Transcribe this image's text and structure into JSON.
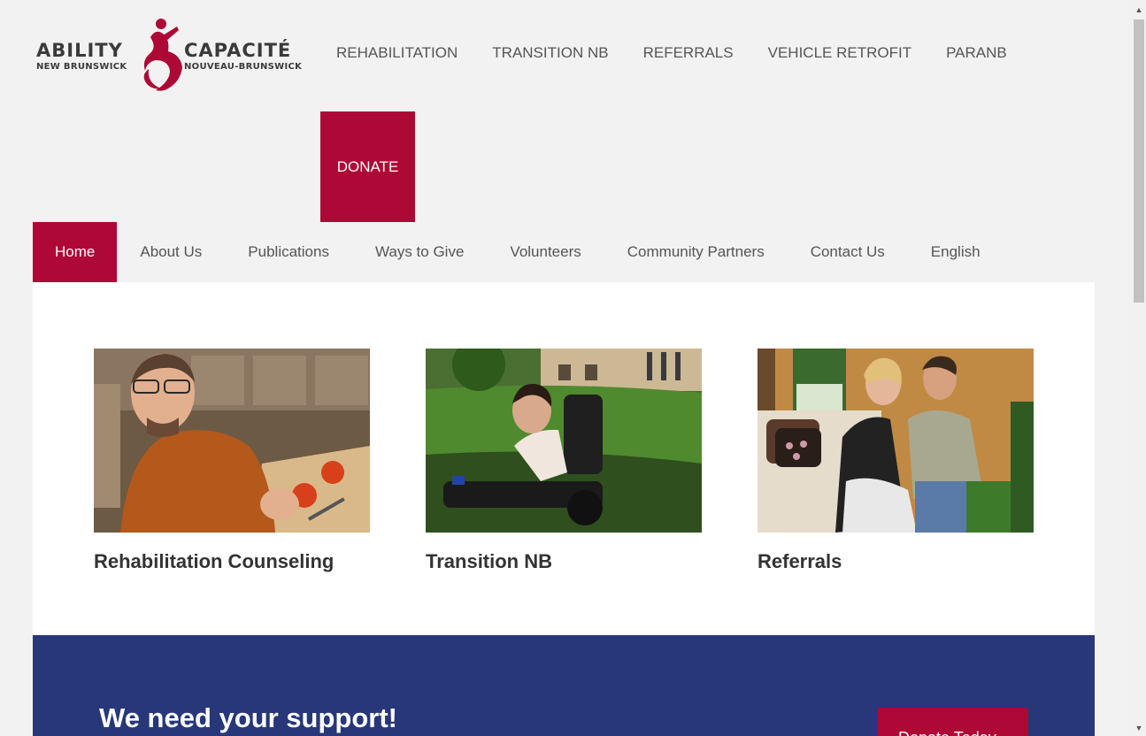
{
  "logo": {
    "left_word": "ABILITY",
    "left_sub": "NEW BRUNSWICK",
    "right_word": "CAPACITÉ",
    "right_sub": "NOUVEAU-BRUNSWICK",
    "icon": "figure-logo-icon",
    "accent": "#ae0936"
  },
  "top_nav": [
    "REHABILITATION",
    "TRANSITION NB",
    "REFERRALS",
    "VEHICLE RETROFIT",
    "PARANB"
  ],
  "donate_label": "DONATE",
  "sub_nav": {
    "items": [
      "Home",
      "About Us",
      "Publications",
      "Ways to Give",
      "Volunteers",
      "Community Partners",
      "Contact Us",
      "English"
    ],
    "active": "Home"
  },
  "tiles": [
    {
      "caption": "Rehabilitation Counseling",
      "image": "man-cutting-tomatoes-photo"
    },
    {
      "caption": "Transition NB",
      "image": "woman-in-wheelchair-photo"
    },
    {
      "caption": "Referrals",
      "image": "couple-on-sofa-photo"
    }
  ],
  "support": {
    "heading": "We need your support!",
    "button": "Donate Today"
  },
  "colors": {
    "brand_red": "#ae0936",
    "navy": "#27377a",
    "page_bg": "#f2f2f2"
  }
}
